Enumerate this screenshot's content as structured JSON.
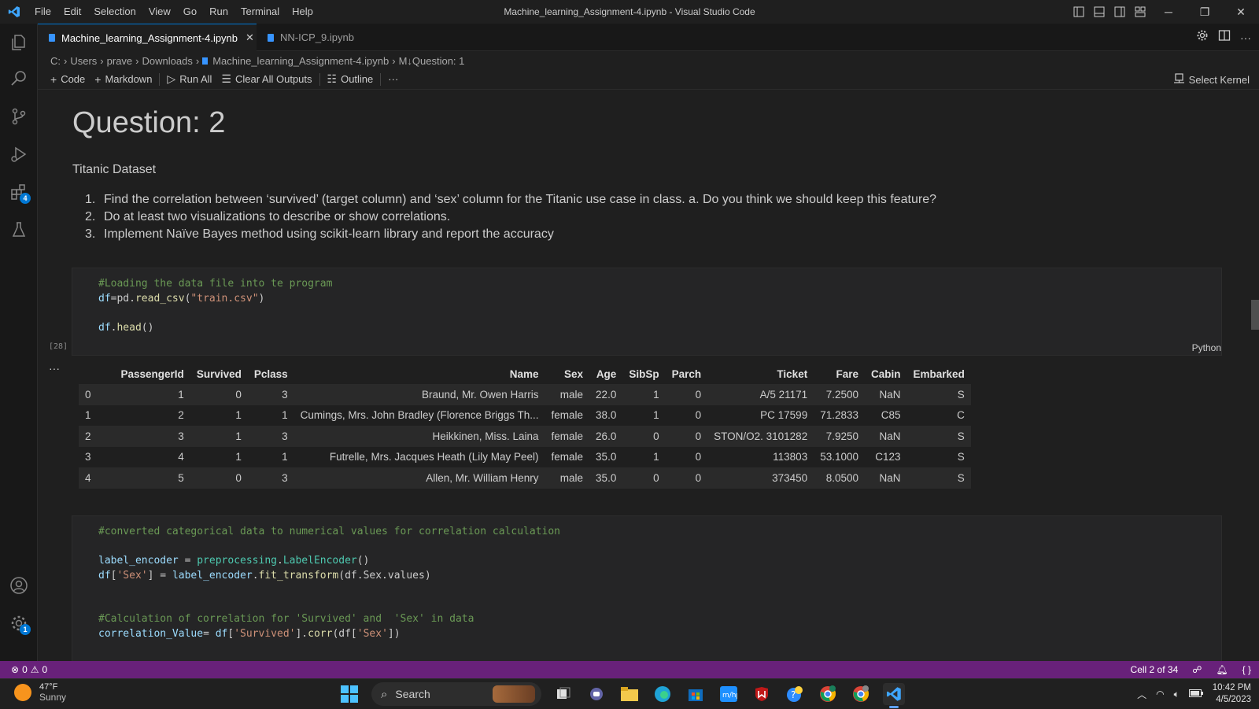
{
  "window": {
    "title": "Machine_learning_Assignment-4.ipynb - Visual Studio Code"
  },
  "menu": [
    "File",
    "Edit",
    "Selection",
    "View",
    "Go",
    "Run",
    "Terminal",
    "Help"
  ],
  "tabs": [
    {
      "label": "Machine_learning_Assignment-4.ipynb",
      "close": "✕"
    },
    {
      "label": "NN-ICP_9.ipynb"
    }
  ],
  "activity_badges": {
    "extensions": "4",
    "settings": "1"
  },
  "breadcrumb": [
    "C:",
    "Users",
    "prave",
    "Downloads",
    "Machine_learning_Assignment-4.ipynb",
    "M↓Question: 1"
  ],
  "toolbar": {
    "code": "Code",
    "markdown": "Markdown",
    "run_all": "Run All",
    "clear_outputs": "Clear All Outputs",
    "outline": "Outline",
    "more": "···",
    "kernel": "Select Kernel"
  },
  "markdown": {
    "heading": "Question: 2",
    "subtitle": "Titanic Dataset",
    "items": [
      "Find the correlation between ‘survived’ (target column) and ‘sex’ column for the Titanic use case in class. a. Do you think we should keep this feature?",
      "Do at least two visualizations to describe or show correlations.",
      "Implement Naïve Bayes method using scikit-learn library and report the accuracy"
    ]
  },
  "cell1": {
    "comment": "#Loading the data file into te program",
    "line2_var": "df",
    "line2_mid": "=pd.",
    "line2_fn": "read_csv",
    "line2_open": "(",
    "line2_str": "\"train.csv\"",
    "line2_close": ")",
    "line3_var": "df",
    "line3_dot": ".",
    "line3_fn": "head",
    "line3_paren": "()",
    "exec_count": "[28]",
    "language": "Python"
  },
  "output": {
    "dots": "···",
    "columns": [
      "",
      "PassengerId",
      "Survived",
      "Pclass",
      "Name",
      "Sex",
      "Age",
      "SibSp",
      "Parch",
      "Ticket",
      "Fare",
      "Cabin",
      "Embarked"
    ],
    "rows": [
      [
        "0",
        "1",
        "0",
        "3",
        "Braund, Mr. Owen Harris",
        "male",
        "22.0",
        "1",
        "0",
        "A/5 21171",
        "7.2500",
        "NaN",
        "S"
      ],
      [
        "1",
        "2",
        "1",
        "1",
        "Cumings, Mrs. John Bradley (Florence Briggs Th...",
        "female",
        "38.0",
        "1",
        "0",
        "PC 17599",
        "71.2833",
        "C85",
        "C"
      ],
      [
        "2",
        "3",
        "1",
        "3",
        "Heikkinen, Miss. Laina",
        "female",
        "26.0",
        "0",
        "0",
        "STON/O2. 3101282",
        "7.9250",
        "NaN",
        "S"
      ],
      [
        "3",
        "4",
        "1",
        "1",
        "Futrelle, Mrs. Jacques Heath (Lily May Peel)",
        "female",
        "35.0",
        "1",
        "0",
        "113803",
        "53.1000",
        "C123",
        "S"
      ],
      [
        "4",
        "5",
        "0",
        "3",
        "Allen, Mr. William Henry",
        "male",
        "35.0",
        "0",
        "0",
        "373450",
        "8.0500",
        "NaN",
        "S"
      ]
    ]
  },
  "cell2": {
    "comment1": "#converted categorical data to numerical values for correlation calculation",
    "l2a": "label_encoder",
    "l2b": " = ",
    "l2c": "preprocessing",
    "l2d": ".",
    "l2e": "LabelEncoder",
    "l2f": "()",
    "l3a": "df",
    "l3b": "[",
    "l3c": "'Sex'",
    "l3d": "] = ",
    "l3e": "label_encoder",
    "l3f": ".",
    "l3g": "fit_transform",
    "l3h": "(df.Sex.values)",
    "comment2": "#Calculation of correlation for 'Survived' and  'Sex' in data",
    "l5a": "correlation_Value",
    "l5b": "= ",
    "l5c": "df",
    "l5d": "[",
    "l5e": "'Survived'",
    "l5f": "].",
    "l5g": "corr",
    "l5h": "(df[",
    "l5i": "'Sex'",
    "l5j": "])"
  },
  "status": {
    "errors": "0",
    "warnings": "0",
    "cell": "Cell 2 of 34"
  },
  "taskbar": {
    "temp": "47°F",
    "condition": "Sunny",
    "search": "Search",
    "time": "10:42 PM",
    "date": "4/5/2023"
  },
  "colors": {
    "accent": "#0078d4",
    "statusbar": "#68217a",
    "comment": "#6a9955",
    "string": "#ce9178"
  }
}
